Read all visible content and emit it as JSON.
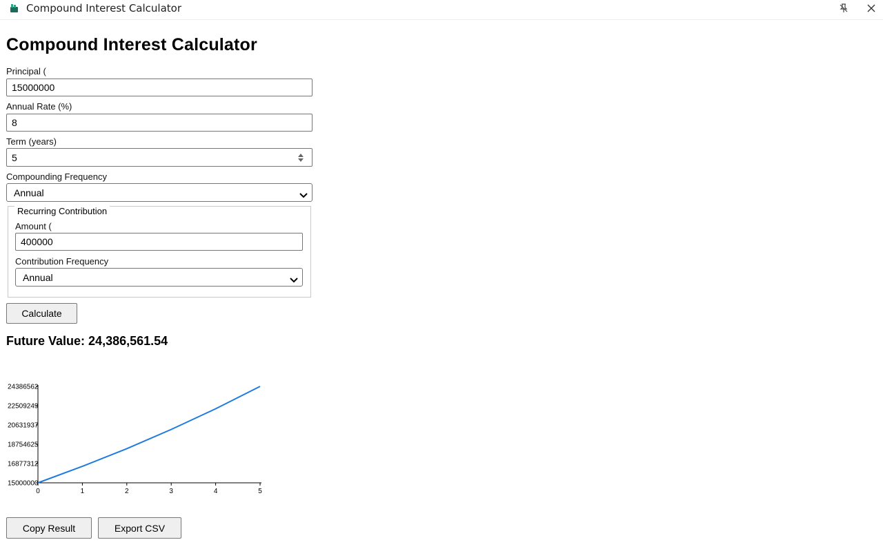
{
  "window": {
    "title": "Compound Interest Calculator",
    "icon": "calculator-app-icon"
  },
  "page": {
    "title": "Compound Interest Calculator"
  },
  "form": {
    "principal": {
      "label": "Principal (",
      "value": "15000000"
    },
    "rate": {
      "label": "Annual Rate (%)",
      "value": "8"
    },
    "term": {
      "label": "Term (years)",
      "value": "5"
    },
    "compounding": {
      "label": "Compounding Frequency",
      "selected": "Annual"
    },
    "recurring": {
      "legend": "Recurring Contribution",
      "amount": {
        "label": "Amount (",
        "value": "400000"
      },
      "frequency": {
        "label": "Contribution Frequency",
        "selected": "Annual"
      }
    },
    "calculate_label": "Calculate"
  },
  "result": {
    "prefix": "Future Value:",
    "value": "24,386,561.54"
  },
  "actions": {
    "copy_label": "Copy Result",
    "export_label": "Export CSV"
  },
  "colors": {
    "line": "#1f7ae0",
    "axis": "#000000"
  },
  "chart_data": {
    "type": "line",
    "x": [
      0,
      1,
      2,
      3,
      4,
      5
    ],
    "y": [
      15000000,
      16600000,
      18328000,
      20194240,
      22209779.2,
      24386561.54
    ],
    "xticks": [
      "0",
      "1",
      "2",
      "3",
      "4",
      "5"
    ],
    "yticks": [
      "15000000",
      "16877312",
      "18754625",
      "20631937",
      "22509249",
      "24386562"
    ],
    "ylim": [
      15000000,
      24386562
    ],
    "xlim": [
      0,
      5
    ],
    "title": "",
    "xlabel": "",
    "ylabel": "",
    "grid": false
  }
}
